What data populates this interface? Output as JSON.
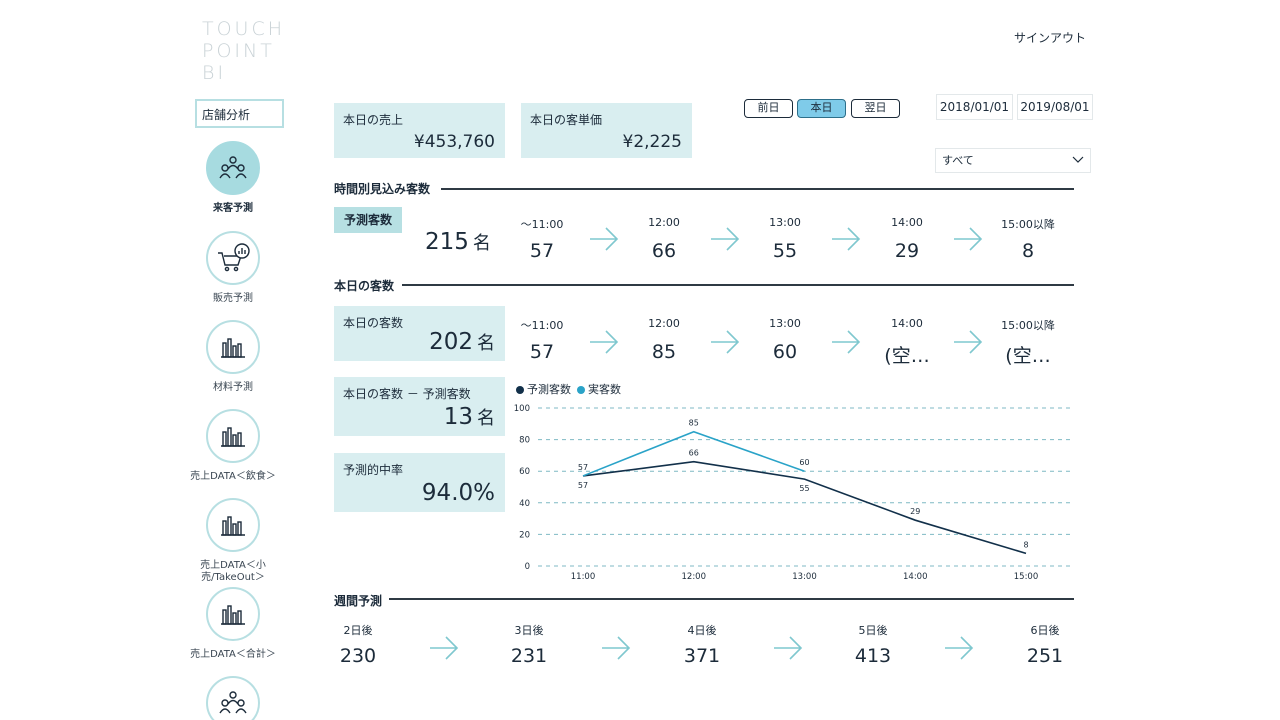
{
  "brand": {
    "line1": "TOUCH",
    "line2": "POINT",
    "line3": "BI"
  },
  "header": {
    "signout": "サインアウト"
  },
  "sidebar": {
    "store_select": "店舗分析",
    "items": [
      {
        "label": "来客予測",
        "icon": "people-icon"
      },
      {
        "label": "販売予測",
        "icon": "cart-chart-icon"
      },
      {
        "label": "材料予測",
        "icon": "bar-chart-icon"
      },
      {
        "label": "売上DATA＜飲食＞",
        "icon": "bar-chart-icon"
      },
      {
        "label": "売上DATA＜小売/TakeOut＞",
        "icon": "bar-chart-icon"
      },
      {
        "label": "売上DATA＜合計＞",
        "icon": "bar-chart-icon"
      }
    ]
  },
  "kpis": {
    "sales_title": "本日の売上",
    "sales_value": "¥453,760",
    "unit_price_title": "本日の客単価",
    "unit_price_value": "¥2,225"
  },
  "day_buttons": {
    "prev": "前日",
    "today": "本日",
    "next": "翌日"
  },
  "dates": {
    "start": "2018/01/01",
    "end": "2019/08/01"
  },
  "filter": {
    "selected": "すべて"
  },
  "forecast_section": {
    "title": "時間別見込み客数",
    "badge": "予測客数",
    "total": "215",
    "unit": "名",
    "slots": [
      {
        "label": "～11:00",
        "value": "57"
      },
      {
        "label": "12:00",
        "value": "66"
      },
      {
        "label": "13:00",
        "value": "55"
      },
      {
        "label": "14:00",
        "value": "29"
      },
      {
        "label": "15:00以降",
        "value": "8"
      }
    ]
  },
  "actual_section": {
    "title": "本日の客数",
    "card_title": "本日の客数",
    "total": "202",
    "unit": "名",
    "slots": [
      {
        "label": "～11:00",
        "value": "57"
      },
      {
        "label": "12:00",
        "value": "85"
      },
      {
        "label": "13:00",
        "value": "60"
      },
      {
        "label": "14:00",
        "value": "(空…"
      },
      {
        "label": "15:00以降",
        "value": "(空…"
      }
    ]
  },
  "diff_card": {
    "title": "本日の客数 － 予測客数",
    "value": "13",
    "unit": "名"
  },
  "accuracy_card": {
    "title": "予測的中率",
    "value": "94.0%"
  },
  "chart_data": {
    "type": "line",
    "x": [
      "11:00",
      "12:00",
      "13:00",
      "14:00",
      "15:00"
    ],
    "ylim": [
      0,
      100
    ],
    "yticks": [
      "0",
      "20",
      "40",
      "60",
      "80",
      "100"
    ],
    "legend_position": "top-left",
    "grid": true,
    "series": [
      {
        "name": "予測客数",
        "color": "#12304a",
        "values": [
          57,
          66,
          55,
          29,
          8
        ]
      },
      {
        "name": "実客数",
        "color": "#2aa3c8",
        "values": [
          57,
          85,
          60,
          null,
          null
        ]
      }
    ]
  },
  "weekly_section": {
    "title": "週間予測",
    "days": [
      {
        "label": "2日後",
        "value": "230"
      },
      {
        "label": "3日後",
        "value": "231"
      },
      {
        "label": "4日後",
        "value": "371"
      },
      {
        "label": "5日後",
        "value": "413"
      },
      {
        "label": "6日後",
        "value": "251"
      }
    ]
  },
  "colors": {
    "accent": "#a7dbe0",
    "card": "#d9eef0",
    "active_button": "#7fcbe9",
    "dark": "#1c2b3a"
  }
}
